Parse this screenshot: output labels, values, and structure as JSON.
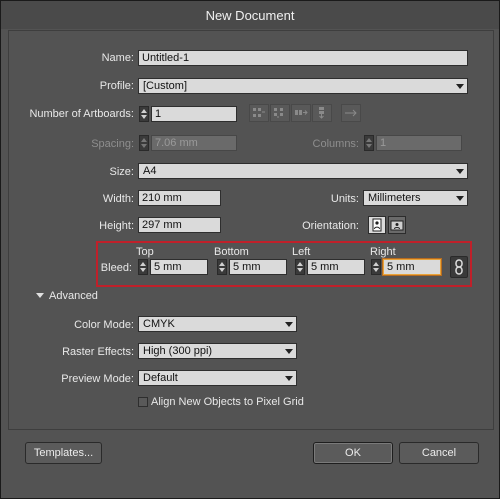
{
  "dialog": {
    "title": "New Document"
  },
  "name": {
    "label": "Name:",
    "value": "Untitled-1"
  },
  "profile": {
    "label": "Profile:",
    "value": "[Custom]"
  },
  "artboards": {
    "label": "Number of Artboards:",
    "value": "1"
  },
  "spacing": {
    "label": "Spacing:",
    "value": "7.06 mm"
  },
  "columns": {
    "label": "Columns:",
    "value": "1"
  },
  "size": {
    "label": "Size:",
    "value": "A4"
  },
  "width": {
    "label": "Width:",
    "value": "210 mm"
  },
  "units": {
    "label": "Units:",
    "value": "Millimeters"
  },
  "height": {
    "label": "Height:",
    "value": "297 mm"
  },
  "orientation": {
    "label": "Orientation:"
  },
  "bleed": {
    "label": "Bleed:",
    "top_label": "Top",
    "top": "5 mm",
    "bottom_label": "Bottom",
    "bottom": "5 mm",
    "left_label": "Left",
    "left": "5 mm",
    "right_label": "Right",
    "right": "5 mm"
  },
  "advanced": {
    "label": "Advanced"
  },
  "color_mode": {
    "label": "Color Mode:",
    "value": "CMYK"
  },
  "raster_effects": {
    "label": "Raster Effects:",
    "value": "High (300 ppi)"
  },
  "preview_mode": {
    "label": "Preview Mode:",
    "value": "Default"
  },
  "align_pixel": {
    "label": "Align New Objects to Pixel Grid",
    "checked": false
  },
  "buttons": {
    "templates": "Templates...",
    "ok": "OK",
    "cancel": "Cancel"
  },
  "colors": {
    "bleed_highlight": "#c0202a",
    "focus": "#e8a33a",
    "background": "#535353"
  }
}
